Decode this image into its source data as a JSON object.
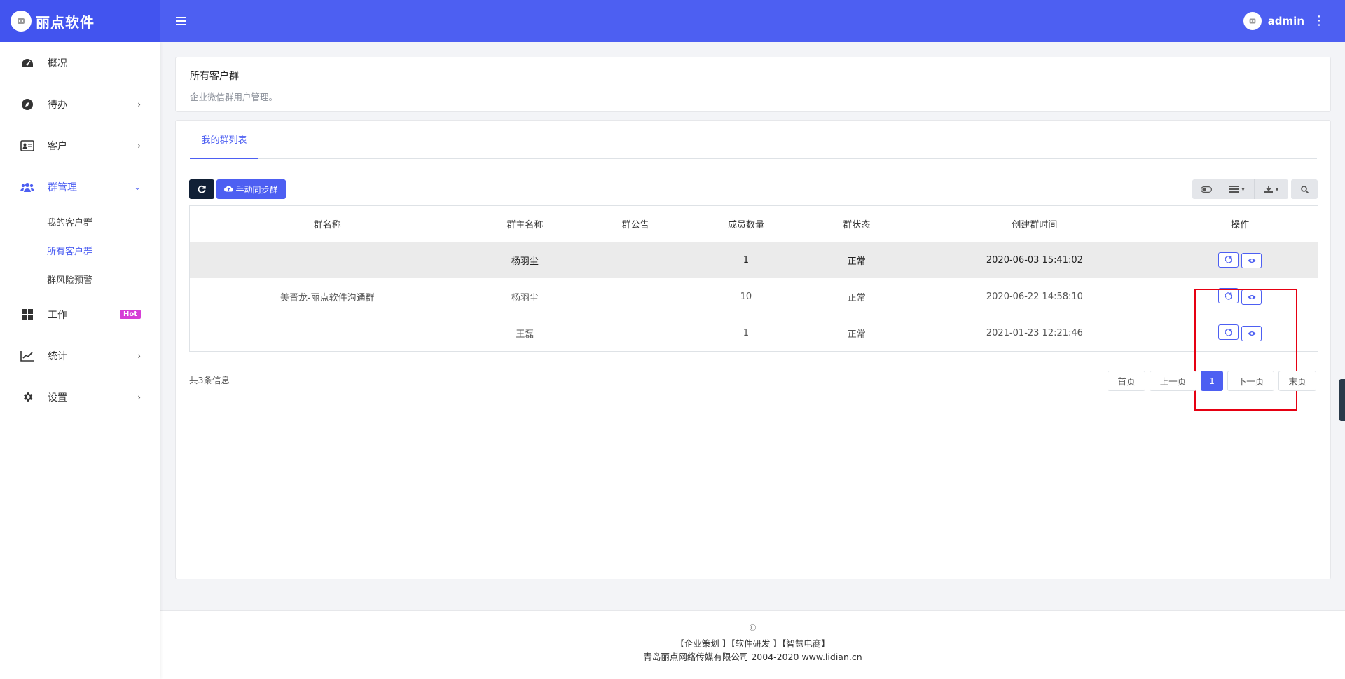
{
  "brand": {
    "name": "丽点软件",
    "logo_icon": "logo-icon"
  },
  "topbar": {
    "menu_icon": "≡",
    "user": "admin"
  },
  "sidebar": {
    "items": [
      {
        "label": "概况",
        "icon": "dashboard-icon"
      },
      {
        "label": "待办",
        "icon": "compass-icon"
      },
      {
        "label": "客户",
        "icon": "id-card-icon"
      },
      {
        "label": "群管理",
        "icon": "users-icon"
      },
      {
        "label": "工作",
        "icon": "grid-icon",
        "badge": "Hot"
      },
      {
        "label": "统计",
        "icon": "chart-line-icon"
      },
      {
        "label": "设置",
        "icon": "gear-icon"
      }
    ],
    "sub_items": [
      "我的客户群",
      "所有客户群",
      "群风险预警"
    ]
  },
  "header": {
    "title": "所有客户群",
    "subtitle": "企业微信群用户管理。"
  },
  "tabs": [
    "我的群列表"
  ],
  "toolbar": {
    "sync_label": "手动同步群"
  },
  "table": {
    "headers": [
      "群名称",
      "群主名称",
      "群公告",
      "成员数量",
      "群状态",
      "创建群时间",
      "操作"
    ],
    "rows": [
      {
        "name": "",
        "owner": "杨羽尘",
        "notice": "",
        "members": "1",
        "status": "正常",
        "created": "2020-06-03 15:41:02"
      },
      {
        "name": "美晋龙-丽点软件沟通群",
        "owner": "杨羽尘",
        "notice": "",
        "members": "10",
        "status": "正常",
        "created": "2020-06-22 14:58:10"
      },
      {
        "name": "",
        "owner": "王磊",
        "notice": "",
        "members": "1",
        "status": "正常",
        "created": "2021-01-23 12:21:46"
      }
    ]
  },
  "pagination": {
    "total": "共3条信息",
    "first": "首页",
    "prev": "上一页",
    "current": "1",
    "next": "下一页",
    "last": "末页"
  },
  "footer": {
    "copyright": "©",
    "links": "【企业策划 】【软件研发 】【智慧电商】",
    "company": "青岛丽点网络传媒有限公司 2004-2020 www.lidian.cn"
  },
  "colors": {
    "primary": "#4d5ff2",
    "dark": "#112036",
    "highlight": "#e60012",
    "hot": "#d63ed6"
  }
}
